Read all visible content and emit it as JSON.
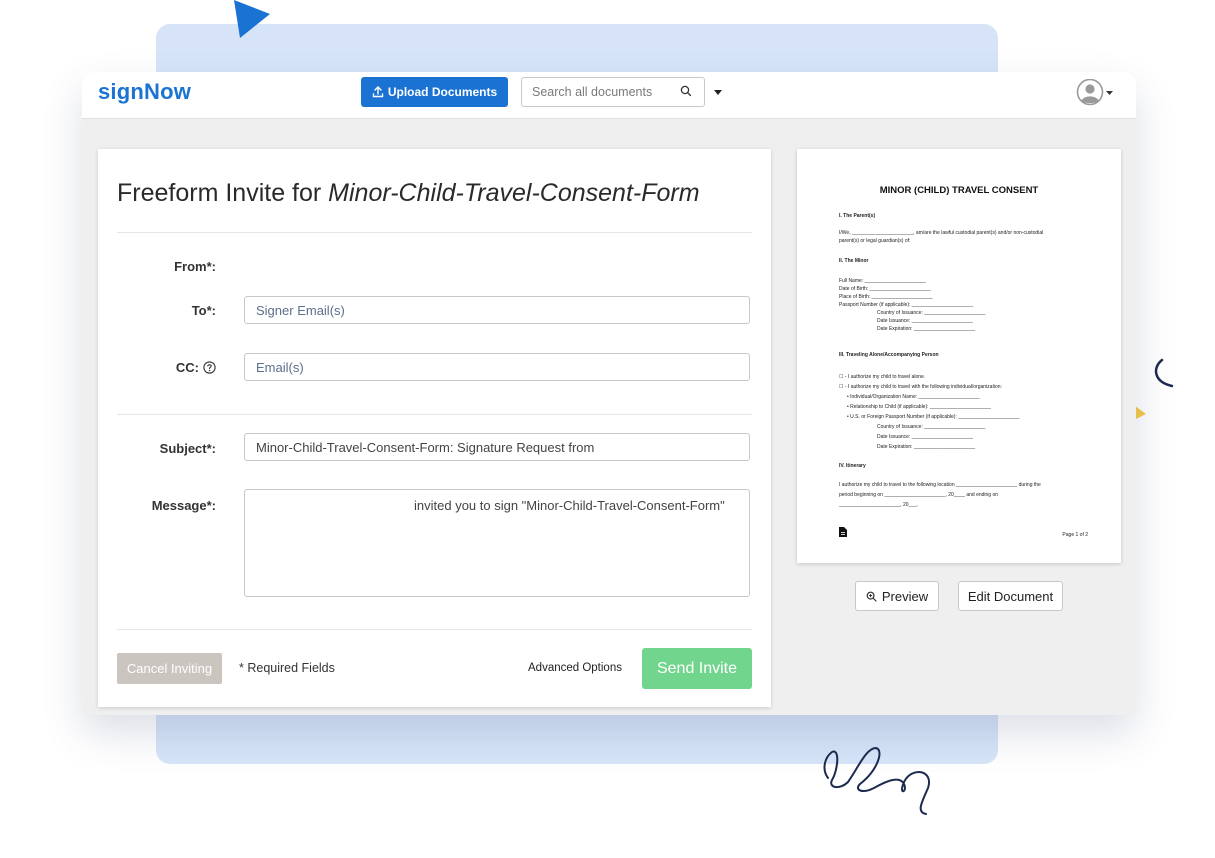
{
  "app": {
    "logo": "signNow"
  },
  "header": {
    "upload_label": "Upload Documents",
    "search_placeholder": "Search all documents"
  },
  "form": {
    "title_prefix": "Freeform Invite for ",
    "title_doc": "Minor-Child-Travel-Consent-Form",
    "from_label": "From*:",
    "to_label": "To*:",
    "to_placeholder": "Signer Email(s)",
    "cc_label": "CC:",
    "cc_placeholder": "Email(s)",
    "subject_label": "Subject*:",
    "subject_value": "Minor-Child-Travel-Consent-Form: Signature Request from",
    "message_label": "Message*:",
    "message_value": "invited you to sign \"Minor-Child-Travel-Consent-Form\"",
    "cancel_label": "Cancel Inviting",
    "required_note": "* Required Fields",
    "advanced_label": "Advanced Options",
    "send_label": "Send Invite"
  },
  "doc_preview": {
    "title": "MINOR (CHILD) TRAVEL CONSENT",
    "lines": [
      "I. The Parent(s)",
      "I/We, ______________________, am/are the lawful custodial parent(s) and/or non-custodial",
      "parent(s) or legal guardian(s) of:",
      "II. The Minor",
      "Full Name: ______________________",
      "Date of Birth: ______________________",
      "Place of Birth: ______________________",
      "Passport Number (if applicable): ______________________",
      "Country of Issuance: ______________________",
      "Date Issuance: ______________________",
      "Date Expiration: ______________________",
      "III. Traveling Alone/Accompanying Person",
      "☐ - I authorize my child to travel alone.",
      "☐ - I authorize my child to travel with the following individual/organization:",
      "• Individual/Organization Name: ______________________",
      "• Relationship to Child (if applicable): ______________________",
      "• U.S. or Foreign Passport Number (if applicable): ______________________",
      "Country of Issuance: ______________________",
      "Date Issuance: ______________________",
      "Date Expiration: ______________________",
      "IV. Itinerary",
      "I authorize my child to travel to the following location ______________________ during the",
      "period beginning on ______________________, 20____ and ending on",
      "______________________, 20___."
    ],
    "page_label": "Page 1 of 2",
    "preview_label": "Preview",
    "edit_label": "Edit Document"
  },
  "colors": {
    "brand_blue": "#1a73d2",
    "send_green": "#72d58d",
    "cancel_gray": "#cbc5c0",
    "panel_blue": "#d7e4f8",
    "deco_yellow": "#f7c948"
  },
  "icons": [
    "upload-icon",
    "search-icon",
    "chevron-down-icon",
    "avatar-icon",
    "help-icon",
    "zoom-icon",
    "file-icon"
  ]
}
